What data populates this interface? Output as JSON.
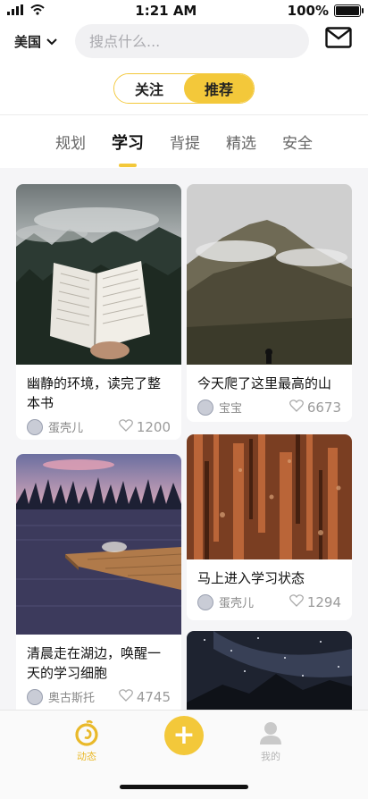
{
  "status_bar": {
    "time": "1:21 AM",
    "battery": "100%",
    "battery_level": 1.0
  },
  "header": {
    "region": "美国",
    "search_placeholder": "搜点什么..."
  },
  "segment": {
    "options": [
      "关注",
      "推荐"
    ],
    "selected": "推荐"
  },
  "tabs": [
    "规划",
    "学习",
    "背提",
    "精选",
    "安全"
  ],
  "active_tab": "学习",
  "feed": [
    {
      "title": "幽静的环境，读完了整本书",
      "author": "蛋壳儿",
      "likes": "1200"
    },
    {
      "title": "今天爬了这里最高的山",
      "author": "宝宝",
      "likes": "6673"
    },
    {
      "title": "马上进入学习状态",
      "author": "蛋壳儿",
      "likes": "1294"
    },
    {
      "title": "清晨走在湖边，唤醒一天的学习细胞",
      "author": "奥古斯托",
      "likes": "4745"
    }
  ],
  "bottom_nav": {
    "home_label": "动态",
    "add_label": "+",
    "me_label": "我的"
  },
  "colors": {
    "accent": "#f3c83a",
    "background": "#f5f5f7"
  },
  "icons": [
    "wifi-icon",
    "signal-icon",
    "chevron-down-icon",
    "mail-icon",
    "heart-icon",
    "home-icon",
    "plus-icon",
    "user-icon"
  ]
}
